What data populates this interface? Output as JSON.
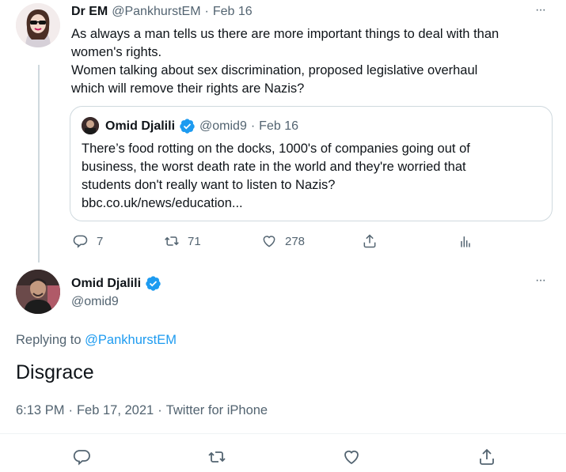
{
  "tweet1": {
    "display_name": "Dr EM",
    "handle": "@PankhurstEM",
    "sep": "·",
    "date": "Feb 16",
    "text_line1": "As always a man tells us there are more important things to deal with than",
    "text_line2": "women's rights.",
    "text_line3": "Women talking about sex discrimination, proposed legislative overhaul",
    "text_line4": "which will remove their rights are Nazis?",
    "more_label": "···",
    "quote": {
      "display_name": "Omid Djalili",
      "handle": "@omid9",
      "sep": "·",
      "date": "Feb 16",
      "line1": "There’s food rotting on the docks, 1000's of companies going out of",
      "line2": "business, the worst death rate in the world and they're worried that",
      "line3": "students don't really want to listen to Nazis?",
      "link": "bbc.co.uk/news/education..."
    },
    "actions": {
      "reply_count": "7",
      "retweet_count": "71",
      "like_count": "278"
    }
  },
  "tweet2": {
    "display_name": "Omid Djalili",
    "handle": "@omid9",
    "more_label": "···",
    "replying_prefix": "Replying to",
    "replying_to": "@PankhurstEM",
    "text": "Disgrace",
    "time": "6:13 PM",
    "sep1": "·",
    "date": "Feb 17, 2021",
    "sep2": "·",
    "source": "Twitter for iPhone"
  },
  "colors": {
    "verified": "#1d9bf0",
    "link": "#1d9bf0",
    "muted": "#536471",
    "border": "#cfd9de"
  },
  "icons": [
    "reply-icon",
    "retweet-icon",
    "like-icon",
    "share-icon",
    "analytics-icon",
    "verified-icon"
  ]
}
